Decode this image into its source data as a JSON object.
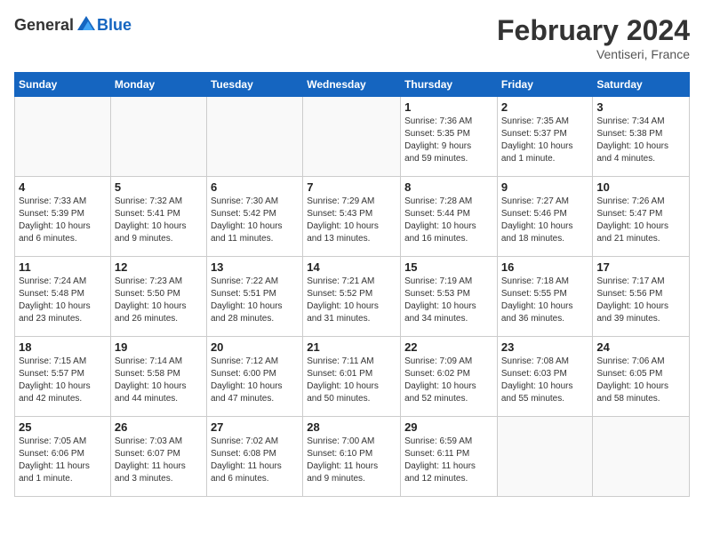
{
  "header": {
    "logo_general": "General",
    "logo_blue": "Blue",
    "title": "February 2024",
    "location": "Ventiseri, France"
  },
  "columns": [
    "Sunday",
    "Monday",
    "Tuesday",
    "Wednesday",
    "Thursday",
    "Friday",
    "Saturday"
  ],
  "weeks": [
    [
      {
        "day": "",
        "info": ""
      },
      {
        "day": "",
        "info": ""
      },
      {
        "day": "",
        "info": ""
      },
      {
        "day": "",
        "info": ""
      },
      {
        "day": "1",
        "info": "Sunrise: 7:36 AM\nSunset: 5:35 PM\nDaylight: 9 hours\nand 59 minutes."
      },
      {
        "day": "2",
        "info": "Sunrise: 7:35 AM\nSunset: 5:37 PM\nDaylight: 10 hours\nand 1 minute."
      },
      {
        "day": "3",
        "info": "Sunrise: 7:34 AM\nSunset: 5:38 PM\nDaylight: 10 hours\nand 4 minutes."
      }
    ],
    [
      {
        "day": "4",
        "info": "Sunrise: 7:33 AM\nSunset: 5:39 PM\nDaylight: 10 hours\nand 6 minutes."
      },
      {
        "day": "5",
        "info": "Sunrise: 7:32 AM\nSunset: 5:41 PM\nDaylight: 10 hours\nand 9 minutes."
      },
      {
        "day": "6",
        "info": "Sunrise: 7:30 AM\nSunset: 5:42 PM\nDaylight: 10 hours\nand 11 minutes."
      },
      {
        "day": "7",
        "info": "Sunrise: 7:29 AM\nSunset: 5:43 PM\nDaylight: 10 hours\nand 13 minutes."
      },
      {
        "day": "8",
        "info": "Sunrise: 7:28 AM\nSunset: 5:44 PM\nDaylight: 10 hours\nand 16 minutes."
      },
      {
        "day": "9",
        "info": "Sunrise: 7:27 AM\nSunset: 5:46 PM\nDaylight: 10 hours\nand 18 minutes."
      },
      {
        "day": "10",
        "info": "Sunrise: 7:26 AM\nSunset: 5:47 PM\nDaylight: 10 hours\nand 21 minutes."
      }
    ],
    [
      {
        "day": "11",
        "info": "Sunrise: 7:24 AM\nSunset: 5:48 PM\nDaylight: 10 hours\nand 23 minutes."
      },
      {
        "day": "12",
        "info": "Sunrise: 7:23 AM\nSunset: 5:50 PM\nDaylight: 10 hours\nand 26 minutes."
      },
      {
        "day": "13",
        "info": "Sunrise: 7:22 AM\nSunset: 5:51 PM\nDaylight: 10 hours\nand 28 minutes."
      },
      {
        "day": "14",
        "info": "Sunrise: 7:21 AM\nSunset: 5:52 PM\nDaylight: 10 hours\nand 31 minutes."
      },
      {
        "day": "15",
        "info": "Sunrise: 7:19 AM\nSunset: 5:53 PM\nDaylight: 10 hours\nand 34 minutes."
      },
      {
        "day": "16",
        "info": "Sunrise: 7:18 AM\nSunset: 5:55 PM\nDaylight: 10 hours\nand 36 minutes."
      },
      {
        "day": "17",
        "info": "Sunrise: 7:17 AM\nSunset: 5:56 PM\nDaylight: 10 hours\nand 39 minutes."
      }
    ],
    [
      {
        "day": "18",
        "info": "Sunrise: 7:15 AM\nSunset: 5:57 PM\nDaylight: 10 hours\nand 42 minutes."
      },
      {
        "day": "19",
        "info": "Sunrise: 7:14 AM\nSunset: 5:58 PM\nDaylight: 10 hours\nand 44 minutes."
      },
      {
        "day": "20",
        "info": "Sunrise: 7:12 AM\nSunset: 6:00 PM\nDaylight: 10 hours\nand 47 minutes."
      },
      {
        "day": "21",
        "info": "Sunrise: 7:11 AM\nSunset: 6:01 PM\nDaylight: 10 hours\nand 50 minutes."
      },
      {
        "day": "22",
        "info": "Sunrise: 7:09 AM\nSunset: 6:02 PM\nDaylight: 10 hours\nand 52 minutes."
      },
      {
        "day": "23",
        "info": "Sunrise: 7:08 AM\nSunset: 6:03 PM\nDaylight: 10 hours\nand 55 minutes."
      },
      {
        "day": "24",
        "info": "Sunrise: 7:06 AM\nSunset: 6:05 PM\nDaylight: 10 hours\nand 58 minutes."
      }
    ],
    [
      {
        "day": "25",
        "info": "Sunrise: 7:05 AM\nSunset: 6:06 PM\nDaylight: 11 hours\nand 1 minute."
      },
      {
        "day": "26",
        "info": "Sunrise: 7:03 AM\nSunset: 6:07 PM\nDaylight: 11 hours\nand 3 minutes."
      },
      {
        "day": "27",
        "info": "Sunrise: 7:02 AM\nSunset: 6:08 PM\nDaylight: 11 hours\nand 6 minutes."
      },
      {
        "day": "28",
        "info": "Sunrise: 7:00 AM\nSunset: 6:10 PM\nDaylight: 11 hours\nand 9 minutes."
      },
      {
        "day": "29",
        "info": "Sunrise: 6:59 AM\nSunset: 6:11 PM\nDaylight: 11 hours\nand 12 minutes."
      },
      {
        "day": "",
        "info": ""
      },
      {
        "day": "",
        "info": ""
      }
    ]
  ]
}
